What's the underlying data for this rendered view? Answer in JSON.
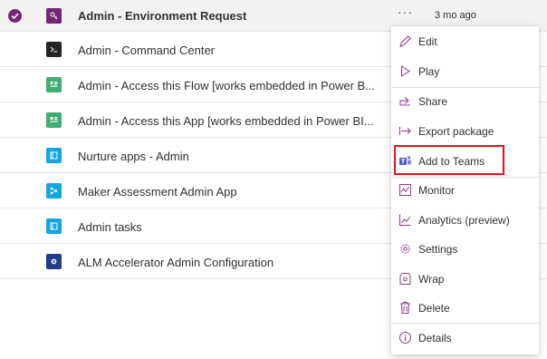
{
  "apps": [
    {
      "name": "Admin - Environment Request",
      "icon": "key-icon",
      "icon_color": "#742774",
      "selected": true,
      "more": "···",
      "modified": "3 mo ago"
    },
    {
      "name": "Admin - Command Center",
      "icon": "command-icon",
      "icon_color": "#252423"
    },
    {
      "name": "Admin - Access this Flow [works embedded in Power B...",
      "icon": "flow-grid-icon",
      "icon_color": "#3fae73"
    },
    {
      "name": "Admin - Access this App [works embedded in Power BI...",
      "icon": "app-grid-icon",
      "icon_color": "#3fae73"
    },
    {
      "name": "Nurture apps - Admin",
      "icon": "book-icon",
      "icon_color": "#13a6e0"
    },
    {
      "name": "Maker Assessment Admin App",
      "icon": "nodes-icon",
      "icon_color": "#13a6e0"
    },
    {
      "name": "Admin tasks",
      "icon": "book-icon",
      "icon_color": "#13a6e0"
    },
    {
      "name": "ALM Accelerator Admin Configuration",
      "icon": "gear-icon",
      "icon_color": "#1f3d8a"
    }
  ],
  "context_menu": {
    "items": [
      {
        "label": "Edit",
        "icon": "pencil-icon"
      },
      {
        "label": "Play",
        "icon": "play-icon"
      },
      {
        "label": "Share",
        "icon": "share-icon"
      },
      {
        "label": "Export package",
        "icon": "export-icon"
      },
      {
        "label": "Add to Teams",
        "icon": "teams-icon",
        "highlighted": true
      },
      {
        "label": "Monitor",
        "icon": "monitor-icon"
      },
      {
        "label": "Analytics (preview)",
        "icon": "analytics-icon"
      },
      {
        "label": "Settings",
        "icon": "gear-icon"
      },
      {
        "label": "Wrap",
        "icon": "wrap-icon"
      },
      {
        "label": "Delete",
        "icon": "trash-icon"
      },
      {
        "label": "Details",
        "icon": "info-icon"
      }
    ]
  },
  "colors": {
    "accent": "#742774",
    "highlight_border": "#e0161f",
    "menu_icon": "#8a3c8a"
  }
}
